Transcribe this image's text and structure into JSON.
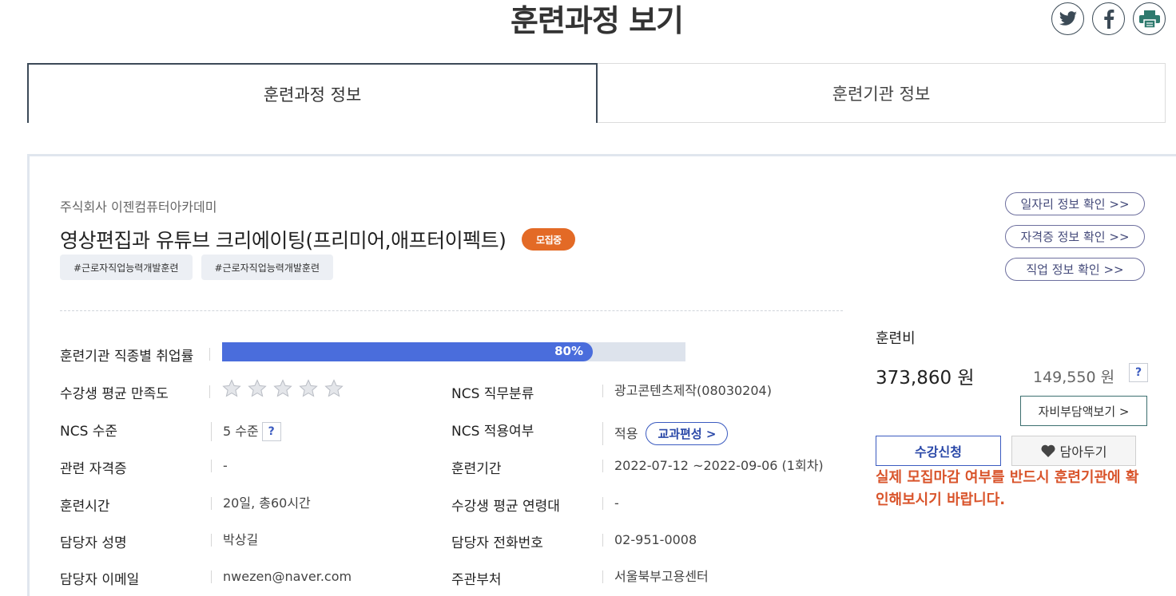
{
  "page": {
    "title": "훈련과정 보기"
  },
  "share": [
    {
      "icon": "twitter-icon"
    },
    {
      "icon": "facebook-icon"
    },
    {
      "icon": "print-icon"
    }
  ],
  "tabs": [
    {
      "label": "훈련과정 정보",
      "active": true
    },
    {
      "label": "훈련기관 정보",
      "active": false
    }
  ],
  "course": {
    "provider": "주식회사 이젠컴퓨터아카데미",
    "title": "영상편집과 유튜브 크리에이팅(프리미어,애프터이펙트)",
    "status_badge": "모집중",
    "tags": [
      "#근로자직업능력개발훈련",
      "#근로자직업능력개발훈련"
    ]
  },
  "links": {
    "job_info": "일자리 정보 확인 >>",
    "cert_info": "자격증 정보 확인 >>",
    "occupation_info": "직업 정보 확인 >>"
  },
  "details": {
    "employment_rate_label": "훈련기관 직종별 취업률",
    "employment_rate_text": "80%",
    "employment_rate_value": 0.8,
    "satisfaction_label": "수강생 평균 만족도",
    "satisfaction_stars_filled": 0,
    "satisfaction_stars_total": 5,
    "ncs_class_label": "NCS 직무분류",
    "ncs_class_value": "광고콘텐츠제작(08030204)",
    "ncs_level_label": "NCS 수준",
    "ncs_level_value": "5 수준",
    "ncs_apply_label": "NCS 적용여부",
    "ncs_apply_value": "적용",
    "curriculum_button": "교과편성 >",
    "cert_label": "관련 자격증",
    "cert_value": "-",
    "period_label": "훈련기간",
    "period_value": "2022-07-12 ~2022-09-06 (1회차)",
    "hours_label": "훈련시간",
    "hours_value": "20일, 총60시간",
    "age_label": "수강생 평균 연령대",
    "age_value": "-",
    "manager_name_label": "담당자 성명",
    "manager_name_value": "박상길",
    "manager_phone_label": "담당자 전화번호",
    "manager_phone_value": "02-951-0008",
    "manager_email_label": "담당자 이메일",
    "manager_email_value": "nwezen@naver.com",
    "dept_label": "주관부처",
    "dept_value": "서울북부고용센터",
    "help_mark": "?"
  },
  "fee": {
    "label": "훈련비",
    "total": "373,860 원",
    "self_pay": "149,550 원",
    "self_pay_button": "자비부담액보기 >",
    "apply_button": "수강신청",
    "wish_button": "담아두기",
    "notice": "실제 모집마감 여부를 반드시 훈련기관에 확인해보시기 바랍니다."
  },
  "colors": {
    "accent_blue": "#4a6ddc",
    "badge_orange": "#e36a26",
    "notice_red": "#d9542b"
  }
}
